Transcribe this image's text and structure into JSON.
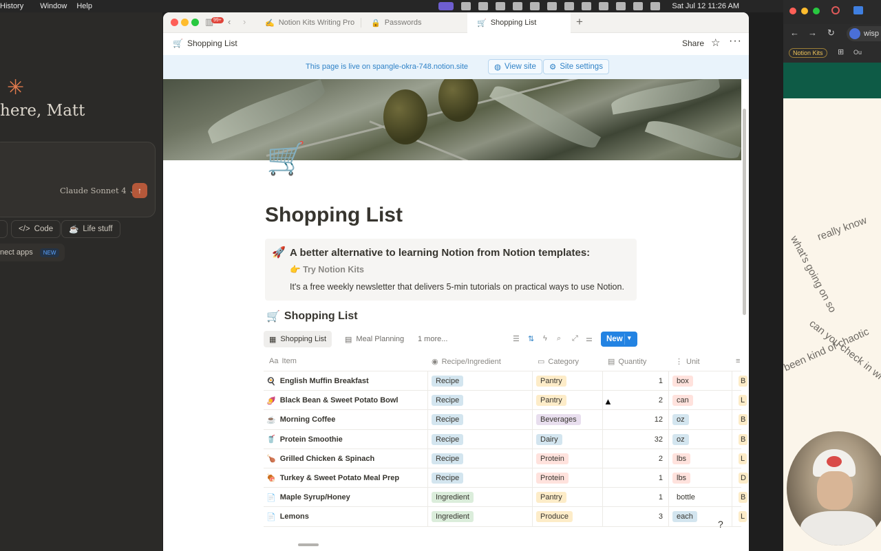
{
  "menubar": {
    "items": [
      "History",
      "Window",
      "Help"
    ],
    "clock": "Sat Jul 12  11:26 AM"
  },
  "claude": {
    "greeting": "here, Matt",
    "model": "Claude Sonnet 4",
    "chips": [
      "Code",
      "Life stuff"
    ],
    "connect": "nect apps",
    "new_badge": "NEW"
  },
  "notion": {
    "badge": "99+",
    "tabs": [
      {
        "label": "Notion Kits Writing Pro",
        "icon": "✍"
      },
      {
        "label": "Passwords",
        "icon": "🔒"
      },
      {
        "label": "Shopping List",
        "icon": "🛒"
      }
    ],
    "breadcrumb": "Shopping List",
    "share": "Share",
    "banner": {
      "text": "This page is live on spangle-okra-748.notion.site",
      "view_site": "View site",
      "site_settings": "Site settings"
    },
    "title": "Shopping List",
    "callout": {
      "heading": "A better alternative to learning Notion from Notion templates:",
      "link": "Try Notion Kits",
      "body": "It's a free weekly newsletter that delivers 5-min tutorials on practical ways to use Notion."
    },
    "database": {
      "title": "Shopping List",
      "views": [
        "Shopping List",
        "Meal Planning",
        "1 more..."
      ],
      "new_label": "New",
      "columns": [
        "Item",
        "Recipe/Ingredient",
        "Category",
        "Quantity",
        "Unit"
      ],
      "rows": [
        {
          "icon": "🍳",
          "item": "English Muffin Breakfast",
          "type": "Recipe",
          "category": "Pantry",
          "qty": "1",
          "unit": "box",
          "extra": "B"
        },
        {
          "icon": "🍠",
          "item": "Black Bean & Sweet Potato Bowl",
          "type": "Recipe",
          "category": "Pantry",
          "qty": "2",
          "unit": "can",
          "extra": "L"
        },
        {
          "icon": "☕",
          "item": "Morning Coffee",
          "type": "Recipe",
          "category": "Beverages",
          "qty": "12",
          "unit": "oz",
          "extra": "B"
        },
        {
          "icon": "🥤",
          "item": "Protein Smoothie",
          "type": "Recipe",
          "category": "Dairy",
          "qty": "32",
          "unit": "oz",
          "extra": "B"
        },
        {
          "icon": "🍗",
          "item": "Grilled Chicken & Spinach",
          "type": "Recipe",
          "category": "Protein",
          "qty": "2",
          "unit": "lbs",
          "extra": "L"
        },
        {
          "icon": "🍖",
          "item": "Turkey & Sweet Potato Meal Prep",
          "type": "Recipe",
          "category": "Protein",
          "qty": "1",
          "unit": "lbs",
          "extra": "D"
        },
        {
          "icon": "📄",
          "item": "Maple Syrup/Honey",
          "type": "Ingredient",
          "category": "Pantry",
          "qty": "1",
          "unit": "bottle",
          "extra": "B"
        },
        {
          "icon": "📄",
          "item": "Lemons",
          "type": "Ingredient",
          "category": "Produce",
          "qty": "3",
          "unit": "each",
          "extra": "L"
        }
      ]
    }
  },
  "right_window": {
    "address": "wisp",
    "bookmark": "Notion Kits",
    "bookmark2": "Ou",
    "circular_text": [
      "really know",
      "what's going on so",
      "been kind of chaotic",
      "can you check in wi"
    ]
  },
  "colors": {
    "accent_blue": "#2383e2",
    "banner_bg": "#e9f3fb",
    "tag_recipe": "#d3e5ef",
    "tag_ingredient": "#dbeddb",
    "cat_pantry": "#fdecc8",
    "cat_beverages": "#e8deee",
    "cat_dairy": "#d3e5ef",
    "cat_protein": "#ffe2dd",
    "cat_produce": "#fdecc8",
    "unit_bg": "#ffe2dd"
  }
}
